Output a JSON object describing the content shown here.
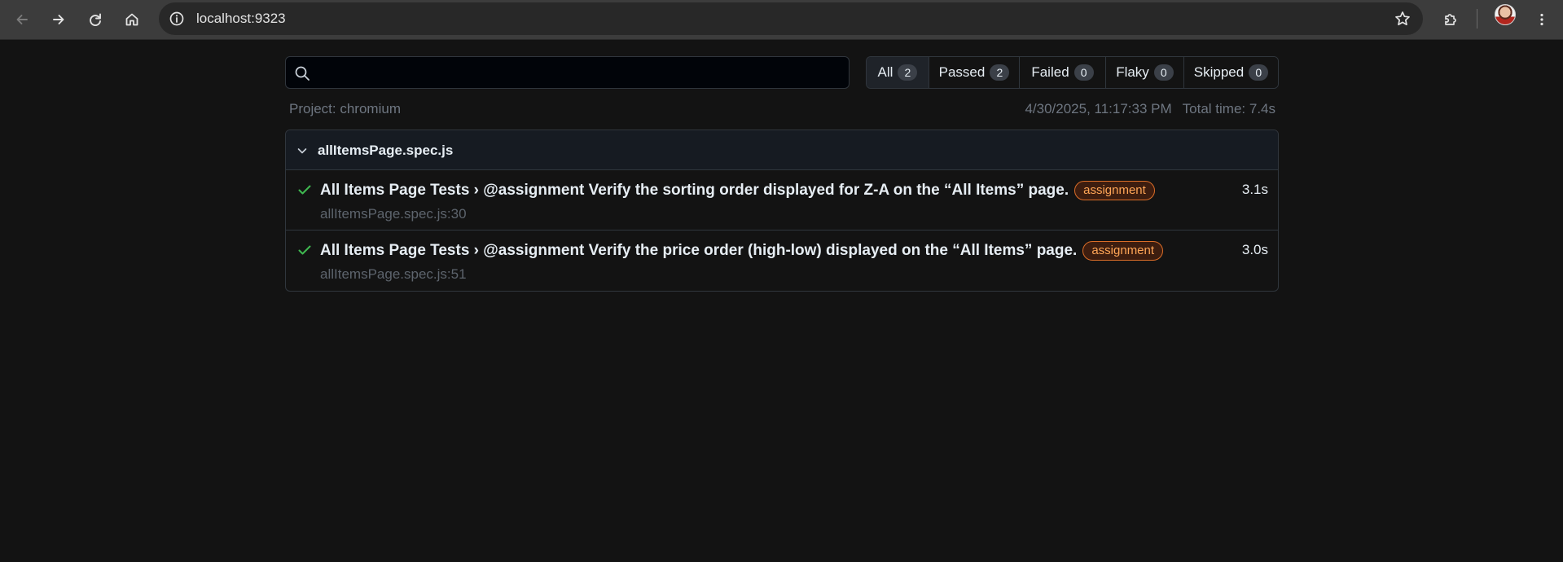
{
  "browser": {
    "url": "localhost:9323"
  },
  "search": {
    "placeholder": "",
    "value": ""
  },
  "filters": [
    {
      "label": "All",
      "count": "2"
    },
    {
      "label": "Passed",
      "count": "2"
    },
    {
      "label": "Failed",
      "count": "0"
    },
    {
      "label": "Flaky",
      "count": "0"
    },
    {
      "label": "Skipped",
      "count": "0"
    }
  ],
  "meta": {
    "project": "Project: chromium",
    "timestamp": "4/30/2025, 11:17:33 PM",
    "total_time": "Total time: 7.4s"
  },
  "file": {
    "name": "allItemsPage.spec.js",
    "tests": [
      {
        "title": "All Items Page Tests › @assignment Verify the sorting order displayed for Z-A on the “All Items” page.",
        "tag": "assignment",
        "location": "allItemsPage.spec.js:30",
        "duration": "3.1s",
        "status": "passed"
      },
      {
        "title": "All Items Page Tests › @assignment Verify the price order (high-low) displayed on the “All Items” page.",
        "tag": "assignment",
        "location": "allItemsPage.spec.js:51",
        "duration": "3.0s",
        "status": "passed"
      }
    ]
  },
  "colors": {
    "background": "#131313",
    "pass_green": "#3fb950",
    "tag_orange": "#ffa657",
    "muted_text": "#6e7681"
  },
  "icons": {
    "back": "arrow-left-icon",
    "forward": "arrow-right-icon",
    "reload": "reload-icon",
    "home": "home-icon",
    "site_info": "info-icon",
    "bookmark": "star-icon",
    "extensions": "puzzle-icon",
    "menu": "kebab-menu-icon",
    "search": "search-icon",
    "expand": "chevron-down-icon",
    "passed": "check-icon"
  }
}
